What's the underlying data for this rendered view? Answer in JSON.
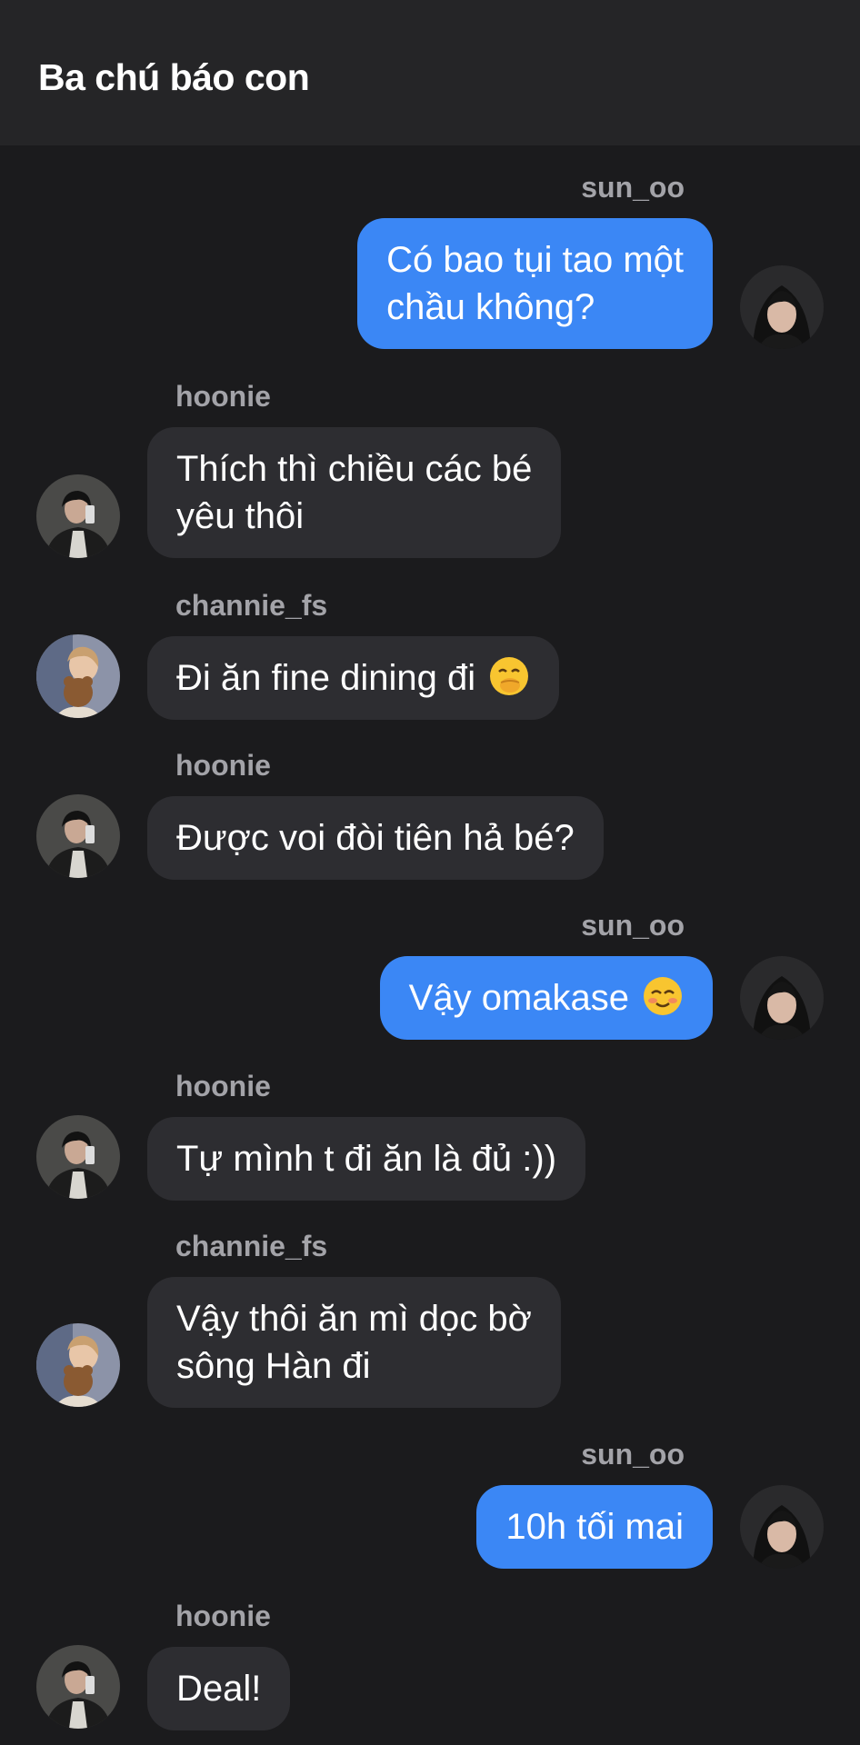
{
  "header": {
    "title": "Ba chú báo con"
  },
  "messages": [
    {
      "sender": "sun_oo",
      "direction": "outgoing",
      "lines": [
        "Có bao tụi tao một",
        "chầu không?"
      ]
    },
    {
      "sender": "hoonie",
      "direction": "incoming",
      "lines": [
        "Thích thì chiều các bé",
        "yêu thôi"
      ]
    },
    {
      "sender": "channie_fs",
      "direction": "incoming",
      "text": "Đi ăn fine dining đi",
      "emoji": "hand-over-mouth-emoji"
    },
    {
      "sender": "hoonie",
      "direction": "incoming",
      "text": "Được voi đòi tiên hả bé?"
    },
    {
      "sender": "sun_oo",
      "direction": "outgoing",
      "text": "Vậy omakase",
      "emoji": "smiling-blushing-emoji"
    },
    {
      "sender": "hoonie",
      "direction": "incoming",
      "text": "Tự mình t đi ăn là đủ :))"
    },
    {
      "sender": "channie_fs",
      "direction": "incoming",
      "lines": [
        "Vậy thôi ăn mì dọc bờ",
        "sông Hàn đi"
      ]
    },
    {
      "sender": "sun_oo",
      "direction": "outgoing",
      "text": "10h tối mai"
    },
    {
      "sender": "hoonie",
      "direction": "incoming",
      "text": "Deal!"
    }
  ],
  "colors": {
    "background": "#1b1b1d",
    "header": "#252527",
    "incoming_bubble": "#2d2d31",
    "outgoing_bubble": "#3b87f5",
    "sender_name": "#a3a3a8"
  }
}
